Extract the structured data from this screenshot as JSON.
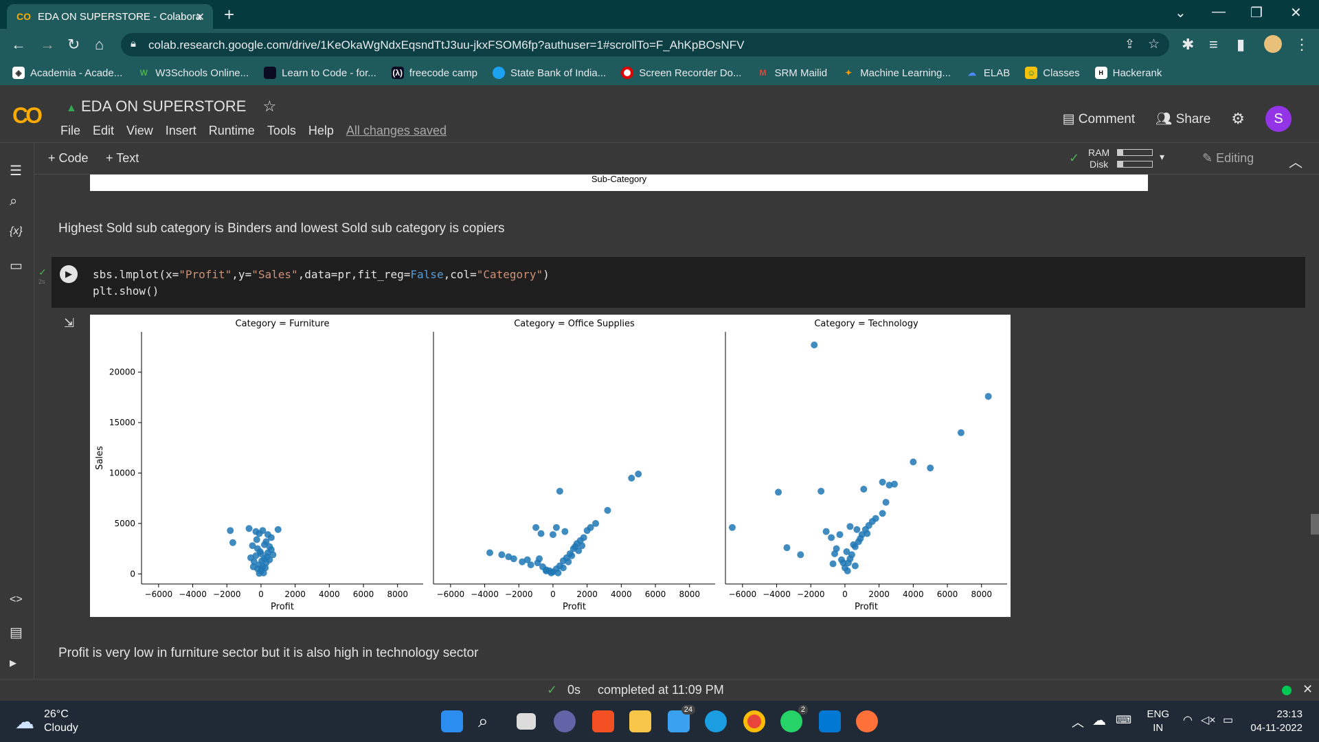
{
  "browser": {
    "tab_title": "EDA ON SUPERSTORE - Colabora",
    "url": "colab.research.google.com/drive/1KeOkaWgNdxEqsndTtJ3uu-jkxFSOM6fp?authuser=1#scrollTo=F_AhKpBOsNFV",
    "bookmarks": [
      "Academia - Acade...",
      "W3Schools Online...",
      "Learn to Code - for...",
      "freecode camp",
      "State Bank of India...",
      "Screen Recorder Do...",
      "SRM Mailid",
      "Machine Learning...",
      "ELAB",
      "Classes",
      "Hackerank"
    ]
  },
  "colab": {
    "logo": "CO",
    "title": "EDA ON SUPERSTORE",
    "menus": [
      "File",
      "Edit",
      "View",
      "Insert",
      "Runtime",
      "Tools",
      "Help"
    ],
    "saved_status": "All changes saved",
    "comment_label": "Comment",
    "share_label": "Share",
    "avatar_letter": "S",
    "add_code": "+ Code",
    "add_text": "+ Text",
    "ram_label": "RAM",
    "disk_label": "Disk",
    "editing_label": "Editing"
  },
  "notebook": {
    "prev_axis_label": "Sub-Category",
    "text1": "Highest Sold sub category is Binders and lowest Sold sub category is copiers",
    "code_line1_a": "sbs.lmplot(x=",
    "code_s1": "\"Profit\"",
    "code_line1_b": ",y=",
    "code_s2": "\"Sales\"",
    "code_line1_c": ",data=pr,fit_reg=",
    "code_kw": "False",
    "code_line1_d": ",col=",
    "code_s3": "\"Category\"",
    "code_line1_e": ")",
    "code_line2": "plt.show()",
    "exec_time": "2s",
    "text2": "Profit is very low in furniture sector but it is also high in technology sector"
  },
  "status": {
    "elapsed": "0s",
    "completed": "completed at 11:09 PM"
  },
  "taskbar": {
    "temp": "26°C",
    "weather": "Cloudy",
    "lang1": "ENG",
    "lang2": "IN",
    "time": "23:13",
    "date": "04-11-2022",
    "mail_badge": "24",
    "whatsapp_badge": "2"
  },
  "chart_data": {
    "type": "scatter",
    "ylabel": "Sales",
    "xlabel": "Profit",
    "xlim": [
      -7000,
      9500
    ],
    "ylim": [
      -1000,
      24000
    ],
    "xticks": [
      -6000,
      -4000,
      -2000,
      0,
      2000,
      4000,
      6000,
      8000
    ],
    "yticks": [
      0,
      5000,
      10000,
      15000,
      20000
    ],
    "xtick_labels": [
      "−6000",
      "−4000",
      "−2000",
      "0",
      "2000",
      "4000",
      "6000",
      "8000"
    ],
    "color": "#1f77b4",
    "panels": [
      {
        "title": "Category = Furniture",
        "points": [
          [
            -1800,
            4300
          ],
          [
            -1650,
            3100
          ],
          [
            -700,
            4500
          ],
          [
            -300,
            4200
          ],
          [
            -100,
            4000
          ],
          [
            100,
            4300
          ],
          [
            400,
            3900
          ],
          [
            1000,
            4400
          ],
          [
            -500,
            2800
          ],
          [
            -200,
            2500
          ],
          [
            300,
            3200
          ],
          [
            500,
            2700
          ],
          [
            -300,
            1800
          ],
          [
            0,
            2000
          ],
          [
            200,
            1500
          ],
          [
            -400,
            1200
          ],
          [
            -100,
            900
          ],
          [
            100,
            700
          ],
          [
            300,
            1100
          ],
          [
            500,
            1400
          ],
          [
            -200,
            500
          ],
          [
            0,
            300
          ],
          [
            150,
            100
          ],
          [
            -100,
            50
          ],
          [
            250,
            600
          ],
          [
            400,
            2100
          ],
          [
            600,
            2400
          ],
          [
            700,
            1900
          ],
          [
            -600,
            1600
          ],
          [
            -450,
            700
          ],
          [
            50,
            1300
          ],
          [
            350,
            1700
          ],
          [
            -50,
            2200
          ],
          [
            200,
            2900
          ],
          [
            -250,
            3400
          ],
          [
            600,
            3600
          ]
        ]
      },
      {
        "title": "Category = Office Supplies",
        "points": [
          [
            -3700,
            2100
          ],
          [
            -3000,
            1900
          ],
          [
            -2300,
            1500
          ],
          [
            -1800,
            1200
          ],
          [
            -1300,
            900
          ],
          [
            -900,
            1100
          ],
          [
            -600,
            700
          ],
          [
            -400,
            400
          ],
          [
            -200,
            300
          ],
          [
            0,
            200
          ],
          [
            200,
            500
          ],
          [
            400,
            800
          ],
          [
            600,
            1300
          ],
          [
            800,
            1600
          ],
          [
            1000,
            2000
          ],
          [
            1200,
            2500
          ],
          [
            1400,
            3000
          ],
          [
            1600,
            3300
          ],
          [
            1800,
            3600
          ],
          [
            2000,
            4300
          ],
          [
            2200,
            4600
          ],
          [
            2500,
            5000
          ],
          [
            3200,
            6300
          ],
          [
            4600,
            9500
          ],
          [
            5000,
            9900
          ],
          [
            400,
            8200
          ],
          [
            -1000,
            4600
          ],
          [
            -700,
            4000
          ],
          [
            0,
            3900
          ],
          [
            200,
            4600
          ],
          [
            700,
            4200
          ],
          [
            -400,
            300
          ],
          [
            300,
            100
          ],
          [
            600,
            600
          ],
          [
            900,
            1200
          ],
          [
            1100,
            1800
          ],
          [
            1300,
            2700
          ],
          [
            -100,
            100
          ],
          [
            -1500,
            1400
          ],
          [
            -2600,
            1700
          ],
          [
            1500,
            2300
          ],
          [
            1700,
            2800
          ],
          [
            -800,
            1500
          ]
        ]
      },
      {
        "title": "Category = Technology",
        "points": [
          [
            -6600,
            4600
          ],
          [
            -3900,
            8100
          ],
          [
            -3400,
            2600
          ],
          [
            -2600,
            1900
          ],
          [
            -1800,
            22700
          ],
          [
            -1400,
            8200
          ],
          [
            -1100,
            4200
          ],
          [
            -800,
            3600
          ],
          [
            -500,
            2500
          ],
          [
            -200,
            1400
          ],
          [
            0,
            600
          ],
          [
            200,
            1100
          ],
          [
            400,
            1900
          ],
          [
            600,
            2700
          ],
          [
            800,
            3200
          ],
          [
            1000,
            3900
          ],
          [
            1200,
            4400
          ],
          [
            1400,
            4800
          ],
          [
            1600,
            5200
          ],
          [
            1800,
            5500
          ],
          [
            2200,
            6000
          ],
          [
            2400,
            7100
          ],
          [
            2600,
            8800
          ],
          [
            1100,
            8400
          ],
          [
            2200,
            9100
          ],
          [
            2900,
            8900
          ],
          [
            4000,
            11100
          ],
          [
            5000,
            10500
          ],
          [
            6800,
            14000
          ],
          [
            8400,
            17600
          ],
          [
            -300,
            3900
          ],
          [
            300,
            4700
          ],
          [
            700,
            4400
          ],
          [
            -600,
            2000
          ],
          [
            100,
            2200
          ],
          [
            500,
            2900
          ],
          [
            900,
            3500
          ],
          [
            1300,
            4000
          ],
          [
            -100,
            1100
          ],
          [
            300,
            1500
          ],
          [
            -700,
            1000
          ],
          [
            600,
            800
          ],
          [
            150,
            300
          ]
        ]
      }
    ]
  }
}
